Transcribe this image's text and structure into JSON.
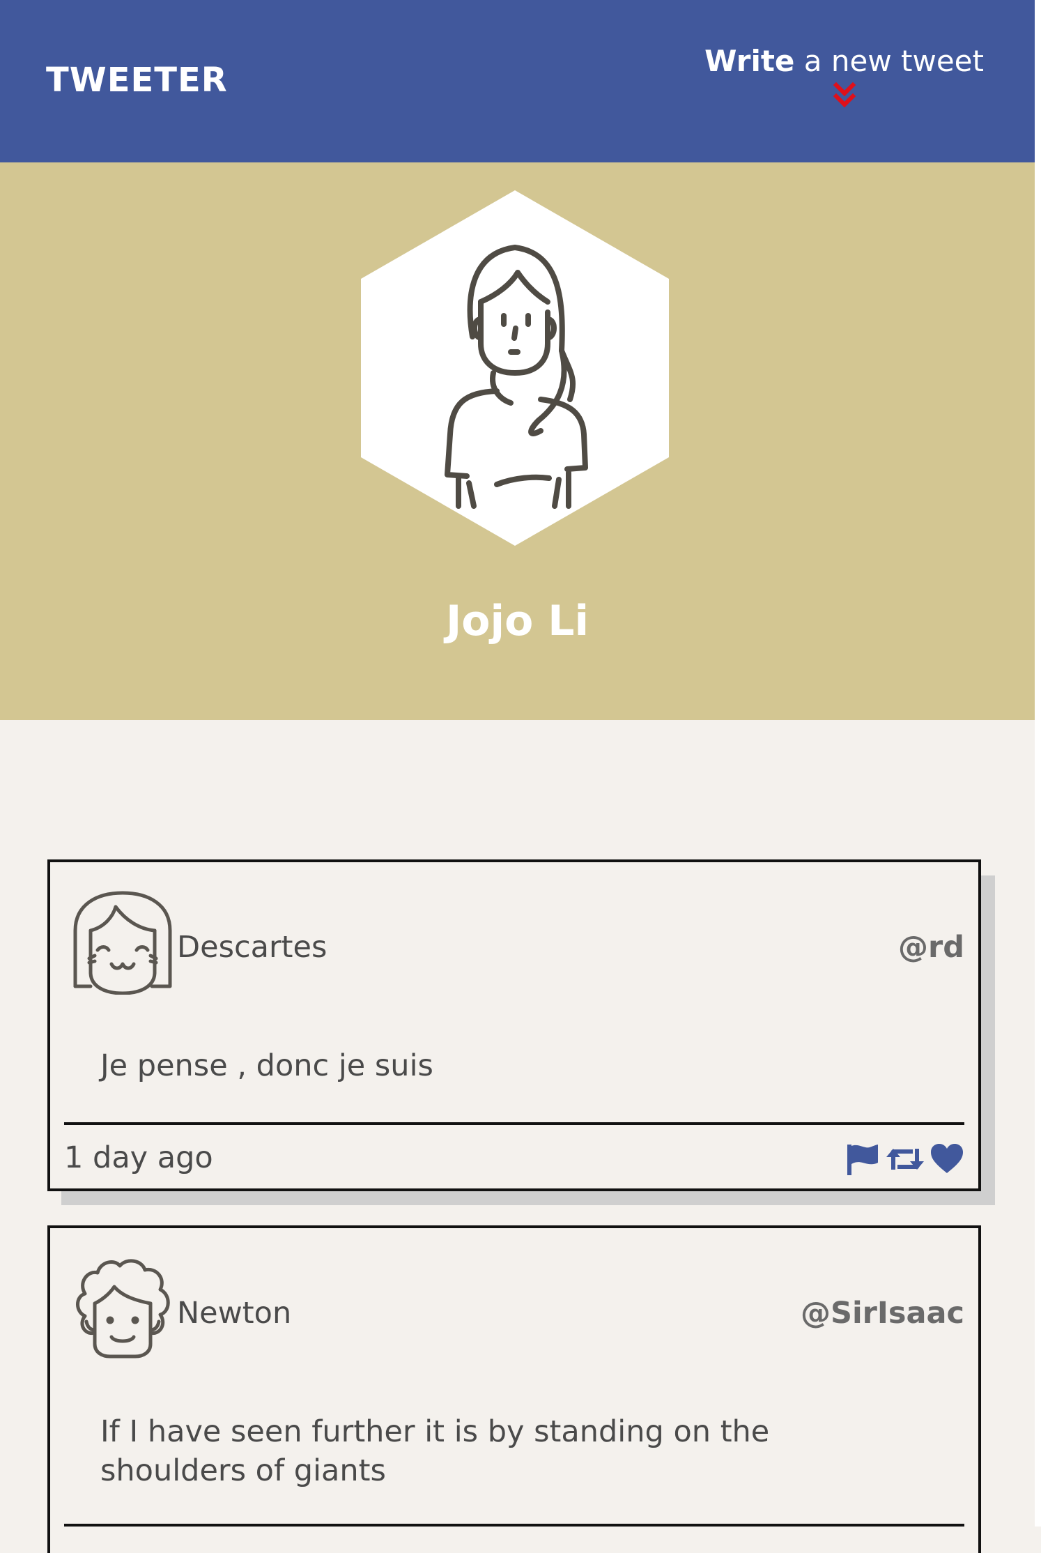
{
  "nav": {
    "brand": "TWEETER",
    "compose_strong": "Write",
    "compose_rest": " a new tweet",
    "compose_arrow_icon": "double-chevron-down-icon",
    "compose_arrow_color": "#e0101a"
  },
  "colors": {
    "nav_background": "#41589c",
    "profile_background": "#d3c692",
    "page_background": "#f4f1ed",
    "action_icon": "#41589c"
  },
  "profile": {
    "name": "Jojo Li",
    "avatar_icon": "woman-avatar-icon"
  },
  "tweets": [
    {
      "name": "Descartes",
      "handle": "@rd",
      "content": "Je pense , donc je suis",
      "time": "1 day ago",
      "avatar_icon": "girl-avatar-icon",
      "actions": [
        "flag-icon",
        "retweet-icon",
        "heart-icon"
      ]
    },
    {
      "name": "Newton",
      "handle": "@SirIsaac",
      "content": "If I have seen further it is by standing on the shoulders of giants",
      "avatar_icon": "curly-hair-avatar-icon"
    }
  ]
}
